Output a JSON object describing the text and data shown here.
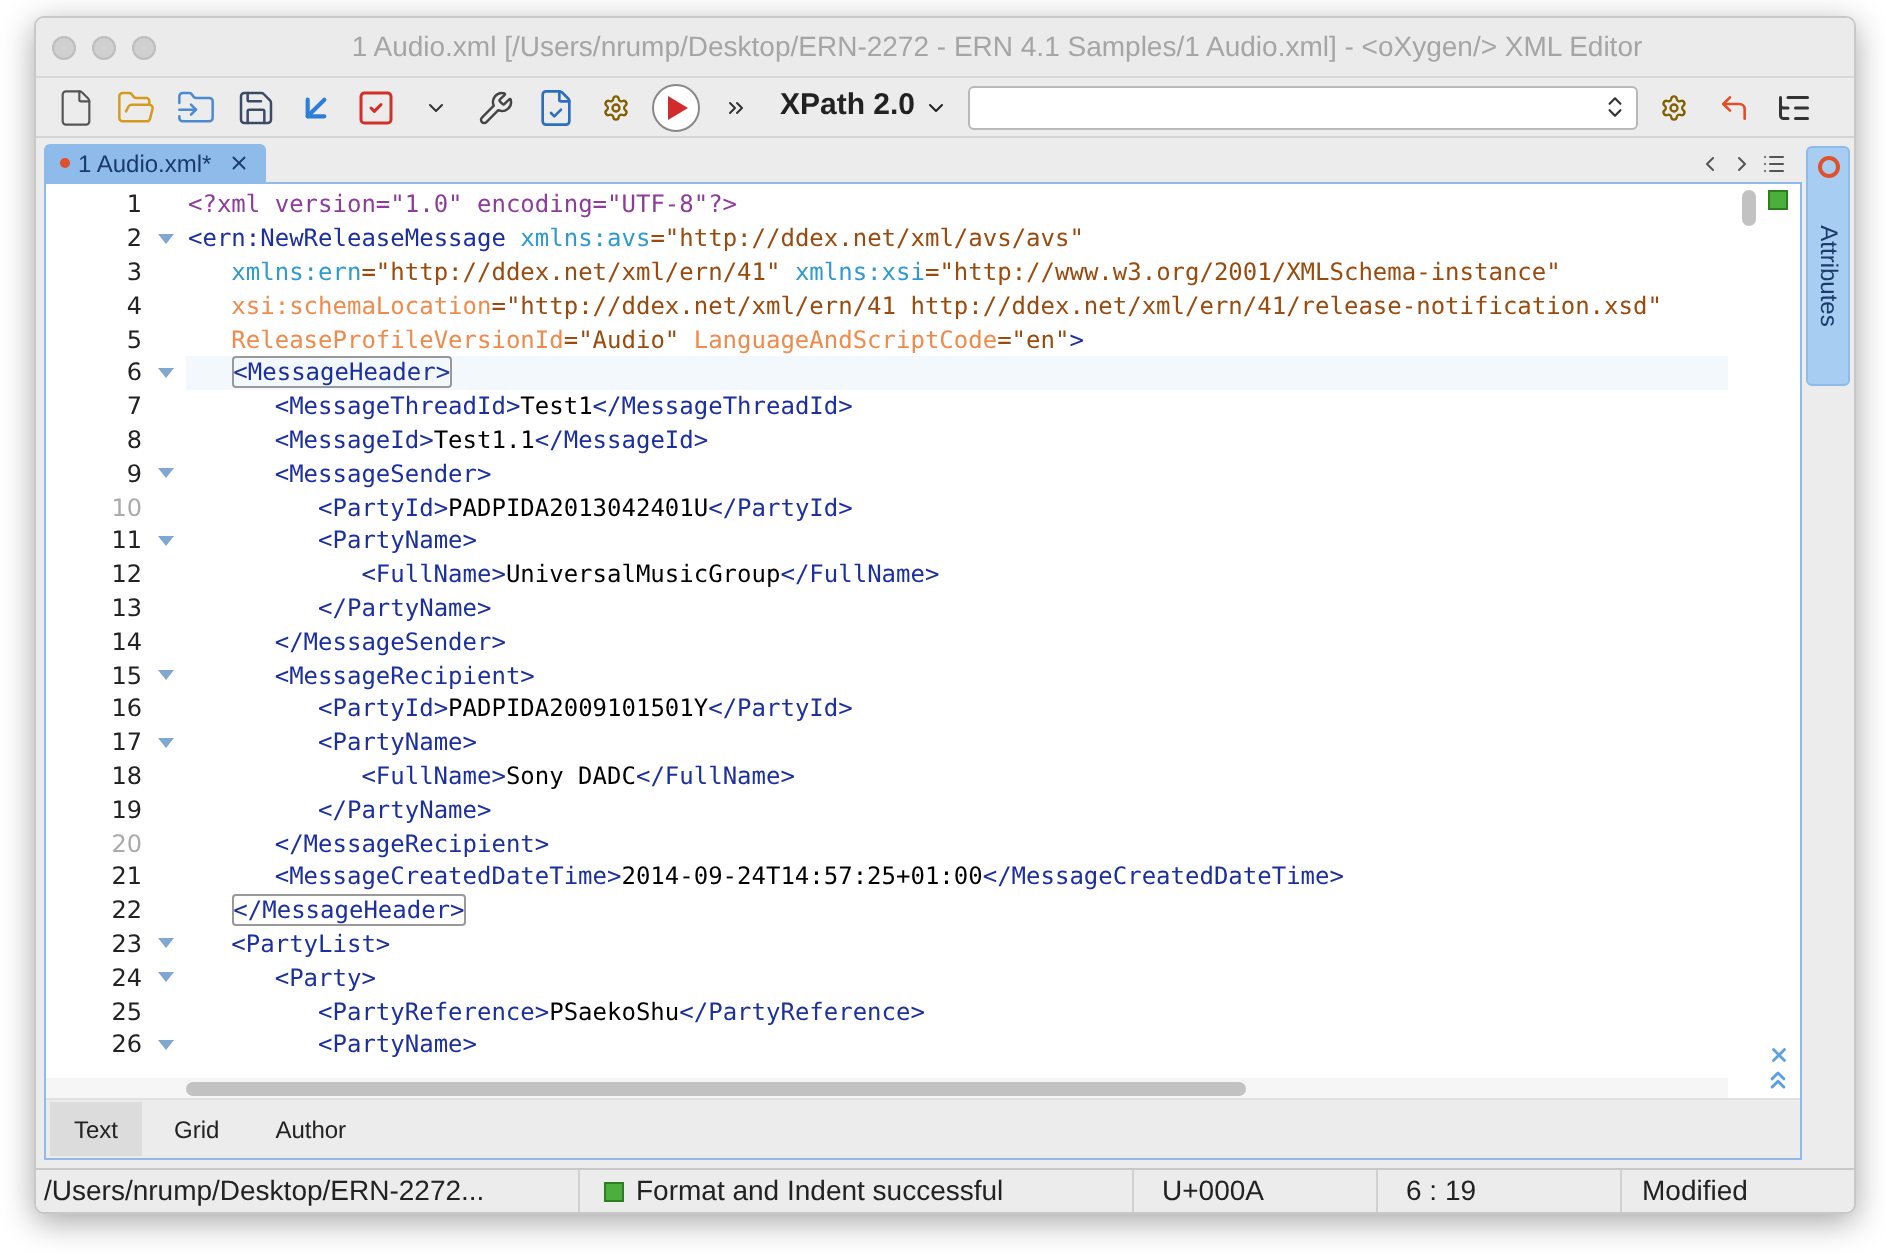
{
  "window": {
    "title": "1 Audio.xml [/Users/nrump/Desktop/ERN-2272 - ERN 4.1 Samples/1 Audio.xml] - <oXygen/> XML Editor"
  },
  "toolbar": {
    "xpath_label": "XPath 2.0"
  },
  "editor_tabs": [
    {
      "label": "1 Audio.xml*",
      "selected": true,
      "modified": true
    }
  ],
  "side_panel": {
    "label": "Attributes"
  },
  "lines": [
    {
      "number": "1",
      "fold": false,
      "muted": false,
      "current": false,
      "tokens": [
        {
          "kind": "pi",
          "text": "<?xml version=\"1.0\" encoding=\"UTF-8\"?>"
        }
      ]
    },
    {
      "number": "2",
      "fold": true,
      "muted": false,
      "current": false,
      "tokens": [
        {
          "kind": "tag",
          "text": "<ern:NewReleaseMessage"
        },
        {
          "kind": "ns",
          "text": "xmlns:avs"
        },
        {
          "kind": "value",
          "text": "=\"http://ddex.net/xml/avs/avs\""
        }
      ],
      "children": [
        {
          "number": "3",
          "fold": false,
          "muted": false,
          "current": false,
          "tokens": [
            {
              "kind": "ns",
              "text": "xmlns:ern"
            },
            {
              "kind": "value",
              "text": "=\"http://ddex.net/xml/ern/41\""
            },
            {
              "kind": "ns",
              "text": "xmlns:xsi"
            },
            {
              "kind": "value",
              "text": "=\"http://www.w3.org/2001/XMLSchema-instance\""
            }
          ]
        },
        {
          "number": "4",
          "fold": false,
          "muted": false,
          "current": false,
          "tokens": [
            {
              "kind": "attr",
              "text": "xsi:schemaLocation"
            },
            {
              "kind": "value",
              "text": "=\"http://ddex.net/xml/ern/41 http://ddex.net/xml/ern/41/release-notification.xsd\""
            }
          ]
        },
        {
          "number": "5",
          "fold": false,
          "muted": false,
          "current": false,
          "tokens": [
            {
              "kind": "attr",
              "text": "ReleaseProfileVersionId"
            },
            {
              "kind": "value",
              "text": "=\"Audio\""
            },
            {
              "kind": "attr",
              "text": "LanguageAndScriptCode"
            },
            {
              "kind": "value",
              "text": "=\"en\""
            },
            {
              "kind": "tag",
              "text": ">"
            }
          ]
        },
        {
          "number": "6",
          "fold": true,
          "muted": false,
          "current": true,
          "tokens": [
            {
              "kind": "match",
              "text": "<MessageHeader>"
            }
          ],
          "children": [
            {
              "number": "7",
              "fold": false,
              "muted": false,
              "current": false,
              "tokens": [
                {
                  "kind": "tag",
                  "text": "<MessageThreadId>"
                },
                {
                  "kind": "text",
                  "text": "Test1"
                },
                {
                  "kind": "tag",
                  "text": "</MessageThreadId>"
                }
              ]
            },
            {
              "number": "8",
              "fold": false,
              "muted": false,
              "current": false,
              "tokens": [
                {
                  "kind": "tag",
                  "text": "<MessageId>"
                },
                {
                  "kind": "text",
                  "text": "Test1.1"
                },
                {
                  "kind": "tag",
                  "text": "</MessageId>"
                }
              ]
            },
            {
              "number": "9",
              "fold": true,
              "muted": false,
              "current": false,
              "tokens": [
                {
                  "kind": "tag",
                  "text": "<MessageSender>"
                }
              ],
              "children": [
                {
                  "number": "10",
                  "fold": false,
                  "muted": true,
                  "current": false,
                  "tokens": [
                    {
                      "kind": "tag",
                      "text": "<PartyId>"
                    },
                    {
                      "kind": "text",
                      "text": "PADPIDA2013042401U"
                    },
                    {
                      "kind": "tag",
                      "text": "</PartyId>"
                    }
                  ]
                },
                {
                  "number": "11",
                  "fold": true,
                  "muted": false,
                  "current": false,
                  "tokens": [
                    {
                      "kind": "tag",
                      "text": "<PartyName>"
                    }
                  ],
                  "children": [
                    {
                      "number": "12",
                      "fold": false,
                      "muted": false,
                      "current": false,
                      "tokens": [
                        {
                          "kind": "tag",
                          "text": "<FullName>"
                        },
                        {
                          "kind": "text",
                          "text": "UniversalMusicGroup"
                        },
                        {
                          "kind": "tag",
                          "text": "</FullName>"
                        }
                      ]
                    }
                  ]
                },
                {
                  "number": "13",
                  "fold": false,
                  "muted": false,
                  "current": false,
                  "tokens": [
                    {
                      "kind": "tag",
                      "text": "</PartyName>"
                    }
                  ]
                }
              ]
            },
            {
              "number": "14",
              "fold": false,
              "muted": false,
              "current": false,
              "tokens": [
                {
                  "kind": "tag",
                  "text": "</MessageSender>"
                }
              ]
            },
            {
              "number": "15",
              "fold": true,
              "muted": false,
              "current": false,
              "tokens": [
                {
                  "kind": "tag",
                  "text": "<MessageRecipient>"
                }
              ],
              "children": [
                {
                  "number": "16",
                  "fold": false,
                  "muted": false,
                  "current": false,
                  "tokens": [
                    {
                      "kind": "tag",
                      "text": "<PartyId>"
                    },
                    {
                      "kind": "text",
                      "text": "PADPIDA2009101501Y"
                    },
                    {
                      "kind": "tag",
                      "text": "</PartyId>"
                    }
                  ]
                },
                {
                  "number": "17",
                  "fold": true,
                  "muted": false,
                  "current": false,
                  "tokens": [
                    {
                      "kind": "tag",
                      "text": "<PartyName>"
                    }
                  ],
                  "children": [
                    {
                      "number": "18",
                      "fold": false,
                      "muted": false,
                      "current": false,
                      "tokens": [
                        {
                          "kind": "tag",
                          "text": "<FullName>"
                        },
                        {
                          "kind": "text",
                          "text": "Sony DADC"
                        },
                        {
                          "kind": "tag",
                          "text": "</FullName>"
                        }
                      ]
                    }
                  ]
                },
                {
                  "number": "19",
                  "fold": false,
                  "muted": false,
                  "current": false,
                  "tokens": [
                    {
                      "kind": "tag",
                      "text": "</PartyName>"
                    }
                  ]
                }
              ]
            },
            {
              "number": "20",
              "fold": false,
              "muted": true,
              "current": false,
              "tokens": [
                {
                  "kind": "tag",
                  "text": "</MessageRecipient>"
                }
              ]
            },
            {
              "number": "21",
              "fold": false,
              "muted": false,
              "current": false,
              "tokens": [
                {
                  "kind": "tag",
                  "text": "<MessageCreatedDateTime>"
                },
                {
                  "kind": "text",
                  "text": "2014-09-24T14:57:25+01:00"
                },
                {
                  "kind": "tag",
                  "text": "</MessageCreatedDateTime>"
                }
              ]
            }
          ]
        },
        {
          "number": "22",
          "fold": false,
          "muted": false,
          "current": false,
          "tokens": [
            {
              "kind": "match",
              "text": "</MessageHeader>"
            }
          ]
        },
        {
          "number": "23",
          "fold": true,
          "muted": false,
          "current": false,
          "tokens": [
            {
              "kind": "tag",
              "text": "<PartyList>"
            }
          ],
          "children": [
            {
              "number": "24",
              "fold": true,
              "muted": false,
              "current": false,
              "tokens": [
                {
                  "kind": "tag",
                  "text": "<Party>"
                }
              ],
              "children": [
                {
                  "number": "25",
                  "fold": false,
                  "muted": false,
                  "current": false,
                  "tokens": [
                    {
                      "kind": "tag",
                      "text": "<PartyReference>"
                    },
                    {
                      "kind": "text",
                      "text": "PSaekoShu"
                    },
                    {
                      "kind": "tag",
                      "text": "</PartyReference>"
                    }
                  ]
                },
                {
                  "number": "26",
                  "fold": true,
                  "muted": false,
                  "current": false,
                  "tokens": [
                    {
                      "kind": "tag",
                      "text": "<PartyName>"
                    }
                  ]
                }
              ]
            }
          ]
        }
      ]
    }
  ],
  "mode_tabs": [
    {
      "label": "Text",
      "selected": true
    },
    {
      "label": "Grid",
      "selected": false
    },
    {
      "label": "Author",
      "selected": false
    }
  ],
  "status_bar": {
    "path": "/Users/nrump/Desktop/ERN-2272...",
    "message": "Format and Indent successful",
    "char": "U+000A",
    "position": "6 : 19",
    "state": "Modified"
  }
}
